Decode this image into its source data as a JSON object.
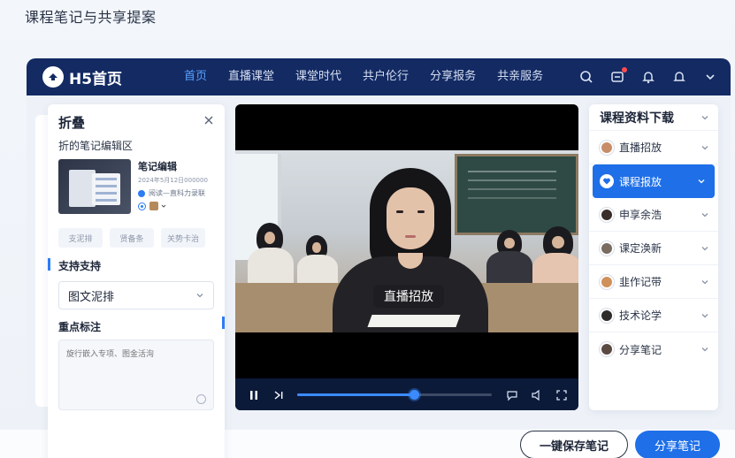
{
  "page_title": "课程笔记与共享提案",
  "navbar": {
    "brand": "H5首页",
    "items": [
      {
        "label": "首页",
        "active": true
      },
      {
        "label": "直播课堂",
        "active": false
      },
      {
        "label": "课堂时代",
        "active": false
      },
      {
        "label": "共户伦行",
        "active": false
      },
      {
        "label": "分享报务",
        "active": false
      },
      {
        "label": "共亲服务",
        "active": false
      }
    ],
    "icons": [
      "search-icon",
      "message-icon",
      "bell-icon",
      "notification-icon",
      "chevron-down-icon"
    ],
    "colors": {
      "bg": "#132a63",
      "active": "#5aa2ff"
    }
  },
  "left_panel": {
    "title": "折叠",
    "subtitle": "折的笔记编辑区",
    "note": {
      "title": "笔记编辑",
      "meta": "2024年5月12日000000",
      "line": "阅读—直科力录联"
    },
    "chips": [
      "支泥排",
      "贤备条",
      "关势卡治"
    ],
    "section1": "支持支持",
    "select_value": "图文泥排",
    "section2": "重点标注",
    "textarea_placeholder": "旋行嵌入专项、图金活洵"
  },
  "video": {
    "caption": "直播招放",
    "progress": 0.6
  },
  "right_panel": {
    "title": "课程资料下载",
    "items": [
      {
        "label": "直播招放",
        "active": false
      },
      {
        "label": "课程报放",
        "active": true
      },
      {
        "label": "申享余浩",
        "active": false
      },
      {
        "label": "课定涣新",
        "active": false
      },
      {
        "label": "韭作记带",
        "active": false
      },
      {
        "label": "技术论学",
        "active": false
      },
      {
        "label": "分享笔记",
        "active": false
      }
    ],
    "accent": "#1e6fe8"
  },
  "footer": {
    "save_label": "一键保存笔记",
    "share_label": "分享笔记"
  }
}
